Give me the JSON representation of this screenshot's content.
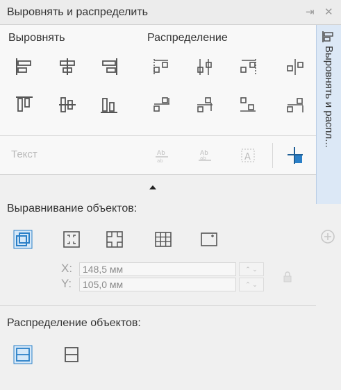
{
  "window": {
    "title": "Выровнять и распределить",
    "pin_glyph": "⇥",
    "close_glyph": "✕"
  },
  "align": {
    "heading": "Выровнять",
    "icons": [
      "align-left-icon",
      "align-center-horizontal-icon",
      "align-right-icon",
      "align-top-icon",
      "align-center-vertical-icon",
      "align-bottom-icon"
    ]
  },
  "distribute": {
    "heading": "Распределение",
    "icons": [
      "distribute-left-icon",
      "distribute-center-horizontal-icon",
      "distribute-spacing-horizontal-icon",
      "distribute-right-icon",
      "distribute-top-icon",
      "distribute-center-vertical-icon",
      "distribute-spacing-vertical-icon",
      "distribute-bottom-icon"
    ]
  },
  "text": {
    "placeholder": "Текст"
  },
  "alignment_objects": {
    "heading": "Выравнивание объектов:",
    "x_label": "X:",
    "y_label": "Y:",
    "x_value": "148,5 мм",
    "y_value": "105,0 мм",
    "spin_glyph": "⌃ ⌄",
    "lock_glyph": "🔒"
  },
  "distribution_objects": {
    "heading": "Распределение объектов:"
  },
  "side_tab": {
    "label": "Выровнять и распл..."
  },
  "colors": {
    "accent_blue": "#2a7fc7",
    "tab_bg": "#dce8f6"
  }
}
